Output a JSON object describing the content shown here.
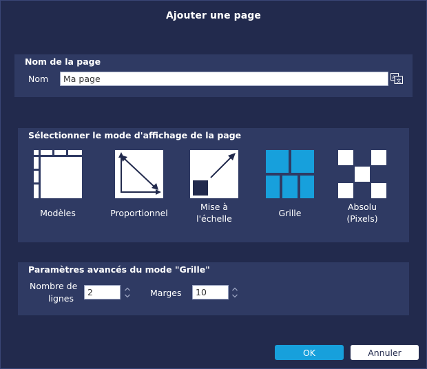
{
  "dialog": {
    "title": "Ajouter une page"
  },
  "page_name": {
    "section_title": "Nom de la page",
    "label": "Nom",
    "value": "Ma page",
    "translate_icon": "translate-icon"
  },
  "display_mode": {
    "section_title": "Sélectionner le mode d'affichage de la page",
    "modes": [
      {
        "label": "Modèles",
        "icon": "templates-icon"
      },
      {
        "label": "Proportionnel",
        "icon": "proportional-icon"
      },
      {
        "label_line1": "Mise à",
        "label_line2": "l'échelle",
        "icon": "scale-icon"
      },
      {
        "label": "Grille",
        "icon": "grid-icon",
        "accent": "#17a0dc"
      },
      {
        "label_line1": "Absolu",
        "label_line2": "(Pixels)",
        "icon": "absolute-icon"
      }
    ]
  },
  "grid_settings": {
    "section_title": "Paramètres avancés du mode \"Grille\"",
    "rows_label_line1": "Nombre de",
    "rows_label_line2": "lignes",
    "rows_value": "2",
    "margins_label": "Marges",
    "margins_value": "10"
  },
  "buttons": {
    "ok": "OK",
    "cancel": "Annuler"
  },
  "colors": {
    "background": "#222a4d",
    "panel": "#2f3a63",
    "accent": "#17a0dc"
  }
}
